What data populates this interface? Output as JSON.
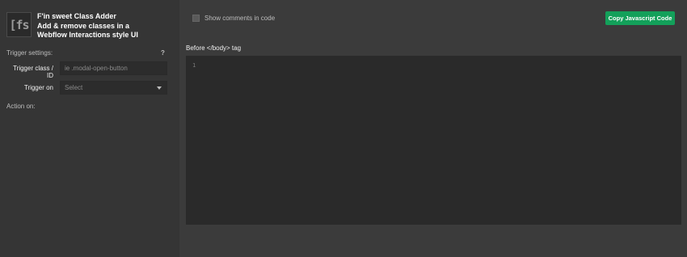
{
  "sidebar": {
    "logo_text": "[fs",
    "title_lines": [
      "F'in sweet Class Adder",
      "Add & remove classes in a",
      "Webflow Interactions style UI"
    ],
    "trigger_settings_label": "Trigger settings:",
    "help_label": "?",
    "trigger_class_label": "Trigger class / ID",
    "trigger_class_placeholder": "ie .modal-open-button",
    "trigger_on_label": "Trigger on",
    "trigger_on_value": "Select",
    "action_on_label": "Action on:"
  },
  "main": {
    "show_comments_label": "Show comments in code",
    "copy_button_label": "Copy Javascript Code",
    "code_title": "Before </body> tag",
    "line_numbers": [
      "1"
    ]
  },
  "colors": {
    "accent_green": "#13a05a",
    "sidebar_bg": "#353535",
    "main_bg": "#3b3b3b",
    "editor_bg": "#2a2a2a"
  }
}
